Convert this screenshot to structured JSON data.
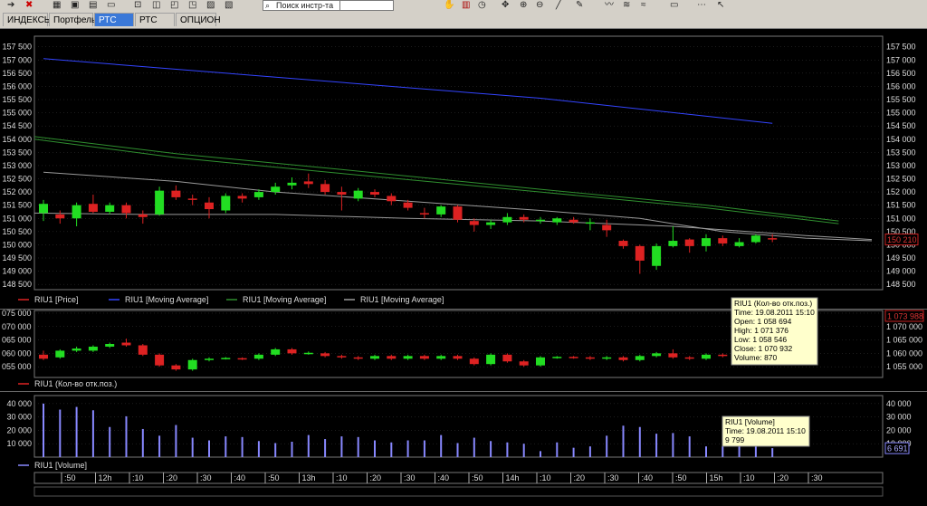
{
  "toolbar": {
    "search_placeholder": "Поиск инстр-та",
    "icons": [
      "arrow-right-icon",
      "close-red-icon",
      "grid-icon",
      "image-icon",
      "chart-icon",
      "window-icon",
      "search-icon",
      "hand-icon",
      "bar-chart-icon",
      "clock-icon",
      "move-icon",
      "zoom-in-icon",
      "zoom-out-icon",
      "line-tool-icon",
      "pen-icon",
      "signal-icon",
      "wave-icon",
      "rectangle-icon",
      "dotted-icon",
      "pointer-icon"
    ]
  },
  "tabs": [
    {
      "label": "ИНДЕКСЫ",
      "active": false
    },
    {
      "label": "Портфель",
      "active": false
    },
    {
      "label": "РТС мин",
      "active": true
    },
    {
      "label": "РТС день",
      "active": false
    },
    {
      "label": "ОПЦИОН",
      "active": false
    }
  ],
  "colors": {
    "background": "#000000",
    "grid": "#3a3a3a",
    "up": "#22dd22",
    "down": "#dd2222",
    "ma_long": "#3344ff",
    "ma_mid": "#2f8f2f",
    "ma_short": "#9a9a9a",
    "volume": "#8888ff",
    "tooltip_bg": "#ffffcc"
  },
  "legend_price": [
    {
      "text": "RIU1 [Price]",
      "color": "#dd2222"
    },
    {
      "text": "RIU1 [Moving Average]",
      "color": "#3344ff"
    },
    {
      "text": "RIU1 [Moving Average]",
      "color": "#2f8f2f"
    },
    {
      "text": "RIU1 [Moving Average]",
      "color": "#9a9a9a"
    }
  ],
  "legend_oi": {
    "text": "RIU1 (Кол-во отк.поз.)",
    "color": "#dd2222"
  },
  "legend_volume": {
    "text": "RIU1 [Volume]",
    "color": "#8888ff"
  },
  "tooltip_oi": {
    "lines": [
      "RIU1 (Кол-во отк.поз.)",
      "Time: 19.08.2011 15:10",
      "Open:  1 058 694",
      "High:   1 071 376",
      "Low:    1 058 546",
      "Close: 1 070 932",
      "Volume: 870"
    ]
  },
  "tooltip_volume": {
    "lines": [
      "RIU1 [Volume]",
      "Time: 19.08.2011 15:10",
      "9 799"
    ]
  },
  "chart_data": [
    {
      "type": "candlestick",
      "name": "price",
      "ylim": [
        148300,
        157900
      ],
      "y_ticks": [
        148500,
        149000,
        149500,
        150000,
        150500,
        151000,
        151500,
        152000,
        152500,
        153000,
        153500,
        154000,
        154500,
        155000,
        155500,
        156000,
        156500,
        157000,
        157500
      ],
      "y_tick_labels": [
        "148 500",
        "149 000",
        "149 500",
        "150 000",
        "150 500",
        "151 000",
        "151 500",
        "152 000",
        "152 500",
        "153 000",
        "153 500",
        "154 000",
        "154 500",
        "155 000",
        "155 500",
        "156 000",
        "156 500",
        "157 000",
        "157 500"
      ],
      "last_value_label": "150 210",
      "candles": [
        {
          "o": 151200,
          "c": 151550,
          "h": 151700,
          "l": 150900
        },
        {
          "o": 151150,
          "c": 151000,
          "h": 151300,
          "l": 150800
        },
        {
          "o": 151000,
          "c": 151500,
          "h": 151600,
          "l": 150700
        },
        {
          "o": 151550,
          "c": 151250,
          "h": 151900,
          "l": 151200
        },
        {
          "o": 151250,
          "c": 151500,
          "h": 151600,
          "l": 151150
        },
        {
          "o": 151500,
          "c": 151200,
          "h": 151600,
          "l": 151000
        },
        {
          "o": 151150,
          "c": 151050,
          "h": 151300,
          "l": 150800
        },
        {
          "o": 151150,
          "c": 152050,
          "h": 152200,
          "l": 151100
        },
        {
          "o": 152050,
          "c": 151800,
          "h": 152250,
          "l": 151700
        },
        {
          "o": 151750,
          "c": 151700,
          "h": 151900,
          "l": 151500
        },
        {
          "o": 151600,
          "c": 151350,
          "h": 151800,
          "l": 151000
        },
        {
          "o": 151300,
          "c": 151850,
          "h": 151950,
          "l": 151200
        },
        {
          "o": 151850,
          "c": 151750,
          "h": 151950,
          "l": 151600
        },
        {
          "o": 151800,
          "c": 152000,
          "h": 152100,
          "l": 151700
        },
        {
          "o": 152000,
          "c": 152200,
          "h": 152350,
          "l": 151900
        },
        {
          "o": 152250,
          "c": 152350,
          "h": 152550,
          "l": 152100
        },
        {
          "o": 152400,
          "c": 152300,
          "h": 152700,
          "l": 152150
        },
        {
          "o": 152300,
          "c": 152000,
          "h": 152450,
          "l": 151900
        },
        {
          "o": 152000,
          "c": 151900,
          "h": 152200,
          "l": 151300
        },
        {
          "o": 151750,
          "c": 152050,
          "h": 152150,
          "l": 151650
        },
        {
          "o": 152000,
          "c": 151900,
          "h": 152100,
          "l": 151800
        },
        {
          "o": 151850,
          "c": 151650,
          "h": 151950,
          "l": 151500
        },
        {
          "o": 151600,
          "c": 151400,
          "h": 151700,
          "l": 151300
        },
        {
          "o": 151200,
          "c": 151150,
          "h": 151400,
          "l": 151000
        },
        {
          "o": 151150,
          "c": 151450,
          "h": 151500,
          "l": 151050
        },
        {
          "o": 151450,
          "c": 150950,
          "h": 151500,
          "l": 150850
        },
        {
          "o": 150900,
          "c": 150750,
          "h": 151000,
          "l": 150500
        },
        {
          "o": 150750,
          "c": 150850,
          "h": 150950,
          "l": 150600
        },
        {
          "o": 150850,
          "c": 151050,
          "h": 151200,
          "l": 150750
        },
        {
          "o": 151050,
          "c": 150950,
          "h": 151150,
          "l": 150850
        },
        {
          "o": 150950,
          "c": 150950,
          "h": 151050,
          "l": 150800
        },
        {
          "o": 150850,
          "c": 151000,
          "h": 151050,
          "l": 150750
        },
        {
          "o": 150950,
          "c": 150850,
          "h": 151050,
          "l": 150800
        },
        {
          "o": 150800,
          "c": 150850,
          "h": 151000,
          "l": 150550
        },
        {
          "o": 150750,
          "c": 150550,
          "h": 150950,
          "l": 150300
        },
        {
          "o": 150150,
          "c": 149950,
          "h": 150200,
          "l": 149850
        },
        {
          "o": 149950,
          "c": 149400,
          "h": 150000,
          "l": 148900
        },
        {
          "o": 149200,
          "c": 149950,
          "h": 150050,
          "l": 149050
        },
        {
          "o": 149950,
          "c": 150150,
          "h": 150700,
          "l": 149900
        },
        {
          "o": 150200,
          "c": 149950,
          "h": 150250,
          "l": 149700
        },
        {
          "o": 149950,
          "c": 150250,
          "h": 150400,
          "l": 149750
        },
        {
          "o": 150250,
          "c": 150050,
          "h": 150350,
          "l": 149950
        },
        {
          "o": 149950,
          "c": 150100,
          "h": 150250,
          "l": 149900
        },
        {
          "o": 150100,
          "c": 150350,
          "h": 150400,
          "l": 150050
        },
        {
          "o": 150250,
          "c": 150200,
          "h": 150400,
          "l": 150100
        }
      ],
      "moving_averages": [
        {
          "color": "#3344ff",
          "points": [
            [
              0,
              157050
            ],
            [
              10,
              156550
            ],
            [
              20,
              156050
            ],
            [
              30,
              155550
            ],
            [
              44,
              154600
            ]
          ]
        },
        {
          "color": "#2f8f2f",
          "points": [
            [
              -0.6,
              154000
            ],
            [
              8,
              153300
            ],
            [
              18,
              152700
            ],
            [
              30,
              152000
            ],
            [
              40,
              151400
            ],
            [
              48,
              150800
            ]
          ]
        },
        {
          "color": "#2f8f2f",
          "points": [
            [
              -0.6,
              154100
            ],
            [
              8,
              153450
            ],
            [
              18,
              152850
            ],
            [
              30,
              152100
            ],
            [
              40,
              151500
            ],
            [
              48,
              150900
            ]
          ]
        },
        {
          "color": "#9a9a9a",
          "points": [
            [
              0,
              152750
            ],
            [
              8,
              152400
            ],
            [
              14,
              152000
            ],
            [
              22,
              151650
            ],
            [
              30,
              151300
            ],
            [
              36,
              151000
            ],
            [
              41,
              150500
            ],
            [
              46,
              150250
            ],
            [
              50,
              150150
            ]
          ]
        },
        {
          "color": "#9a9a9a",
          "points": [
            [
              -0.6,
              151200
            ],
            [
              6,
              151150
            ],
            [
              14,
              151150
            ],
            [
              22,
              151000
            ],
            [
              30,
              150900
            ],
            [
              38,
              150700
            ],
            [
              46,
              150350
            ],
            [
              50,
              150200
            ]
          ]
        }
      ]
    },
    {
      "type": "candlestick",
      "name": "open_interest",
      "ylim": [
        1051000,
        1076000
      ],
      "y_ticks": [
        1055000,
        1060000,
        1065000,
        1070000
      ],
      "y_tick_labels": [
        "1 055 000",
        "1 060 000",
        "1 065 000",
        "1 070 000"
      ],
      "left_tick_labels": [
        "055 000",
        "060 000",
        "065 000",
        "070 000",
        "075 000"
      ],
      "left_ticks": [
        1055000,
        1060000,
        1065000,
        1070000,
        1075000
      ],
      "last_value_label": "1 073 988",
      "candles": [
        {
          "o": 1059500,
          "c": 1058000,
          "h": 1061000,
          "l": 1057500
        },
        {
          "o": 1058500,
          "c": 1061000,
          "h": 1061500,
          "l": 1058000
        },
        {
          "o": 1061000,
          "c": 1061800,
          "h": 1062500,
          "l": 1060500
        },
        {
          "o": 1061000,
          "c": 1062500,
          "h": 1063000,
          "l": 1060500
        },
        {
          "o": 1062500,
          "c": 1063500,
          "h": 1064000,
          "l": 1062000
        },
        {
          "o": 1064000,
          "c": 1063000,
          "h": 1065500,
          "l": 1062500
        },
        {
          "o": 1063000,
          "c": 1059500,
          "h": 1063500,
          "l": 1059000
        },
        {
          "o": 1059500,
          "c": 1055500,
          "h": 1060000,
          "l": 1055000
        },
        {
          "o": 1055500,
          "c": 1054000,
          "h": 1056000,
          "l": 1053500
        },
        {
          "o": 1054000,
          "c": 1057500,
          "h": 1058000,
          "l": 1053500
        },
        {
          "o": 1057500,
          "c": 1058000,
          "h": 1058500,
          "l": 1057000
        },
        {
          "o": 1058000,
          "c": 1058300,
          "h": 1058600,
          "l": 1057700
        },
        {
          "o": 1058200,
          "c": 1058000,
          "h": 1058500,
          "l": 1057500
        },
        {
          "o": 1058000,
          "c": 1059500,
          "h": 1060000,
          "l": 1057500
        },
        {
          "o": 1059500,
          "c": 1061500,
          "h": 1062000,
          "l": 1059000
        },
        {
          "o": 1061500,
          "c": 1060000,
          "h": 1062000,
          "l": 1059500
        },
        {
          "o": 1060000,
          "c": 1060200,
          "h": 1060700,
          "l": 1059500
        },
        {
          "o": 1060000,
          "c": 1059000,
          "h": 1060500,
          "l": 1058500
        },
        {
          "o": 1059000,
          "c": 1058500,
          "h": 1059500,
          "l": 1058000
        },
        {
          "o": 1058500,
          "c": 1058000,
          "h": 1059000,
          "l": 1057500
        },
        {
          "o": 1058000,
          "c": 1059000,
          "h": 1059500,
          "l": 1057500
        },
        {
          "o": 1059000,
          "c": 1058000,
          "h": 1059500,
          "l": 1057500
        },
        {
          "o": 1058000,
          "c": 1059000,
          "h": 1059500,
          "l": 1057500
        },
        {
          "o": 1059000,
          "c": 1058000,
          "h": 1059500,
          "l": 1057500
        },
        {
          "o": 1058000,
          "c": 1059000,
          "h": 1059500,
          "l": 1057500
        },
        {
          "o": 1059000,
          "c": 1058000,
          "h": 1059500,
          "l": 1057500
        },
        {
          "o": 1058000,
          "c": 1056000,
          "h": 1058500,
          "l": 1055500
        },
        {
          "o": 1056000,
          "c": 1059500,
          "h": 1060000,
          "l": 1055500
        },
        {
          "o": 1059500,
          "c": 1057000,
          "h": 1060000,
          "l": 1056500
        },
        {
          "o": 1057000,
          "c": 1055500,
          "h": 1057500,
          "l": 1055000
        },
        {
          "o": 1055500,
          "c": 1058500,
          "h": 1059000,
          "l": 1055000
        },
        {
          "o": 1058500,
          "c": 1058700,
          "h": 1059000,
          "l": 1058000
        },
        {
          "o": 1058700,
          "c": 1058500,
          "h": 1059000,
          "l": 1058000
        },
        {
          "o": 1058500,
          "c": 1058000,
          "h": 1059000,
          "l": 1057500
        },
        {
          "o": 1058000,
          "c": 1058500,
          "h": 1059000,
          "l": 1057500
        },
        {
          "o": 1058500,
          "c": 1057500,
          "h": 1059000,
          "l": 1057000
        },
        {
          "o": 1057500,
          "c": 1059000,
          "h": 1059500,
          "l": 1057000
        },
        {
          "o": 1059000,
          "c": 1060000,
          "h": 1060500,
          "l": 1058500
        },
        {
          "o": 1060000,
          "c": 1058500,
          "h": 1061500,
          "l": 1058000
        },
        {
          "o": 1058500,
          "c": 1058000,
          "h": 1059000,
          "l": 1057500
        },
        {
          "o": 1058000,
          "c": 1059500,
          "h": 1060000,
          "l": 1057500
        },
        {
          "o": 1059500,
          "c": 1059000,
          "h": 1060000,
          "l": 1058500
        },
        {
          "o": 1059000,
          "c": 1058000,
          "h": 1059500,
          "l": 1057500
        },
        {
          "o": 1058694,
          "c": 1070932,
          "h": 1071376,
          "l": 1058546
        }
      ]
    },
    {
      "type": "bar",
      "name": "volume",
      "ylim": [
        0,
        46000
      ],
      "y_ticks": [
        10000,
        20000,
        30000,
        40000
      ],
      "y_tick_labels": [
        "10 000",
        "20 000",
        "30 000",
        "40 000"
      ],
      "last_value_label": "6 691",
      "values": [
        40000,
        35500,
        37500,
        35000,
        22500,
        30500,
        21000,
        16000,
        24000,
        14500,
        12500,
        15500,
        15000,
        12000,
        10500,
        11500,
        16500,
        13500,
        15500,
        15000,
        12500,
        11000,
        12500,
        12500,
        16500,
        10500,
        14500,
        12000,
        11000,
        10000,
        4500,
        11000,
        7000,
        8000,
        16000,
        23500,
        22500,
        17500,
        18000,
        15500,
        8000,
        8000,
        9799,
        8500,
        6691
      ],
      "x_tick_labels": [
        ":50",
        "12h",
        ":10",
        ":20",
        ":30",
        ":40",
        ":50",
        "13h",
        ":10",
        ":20",
        ":30",
        ":40",
        ":50",
        "14h",
        ":10",
        ":20",
        ":30",
        ":40",
        ":50",
        "15h",
        ":10",
        ":20",
        ":30"
      ]
    }
  ]
}
